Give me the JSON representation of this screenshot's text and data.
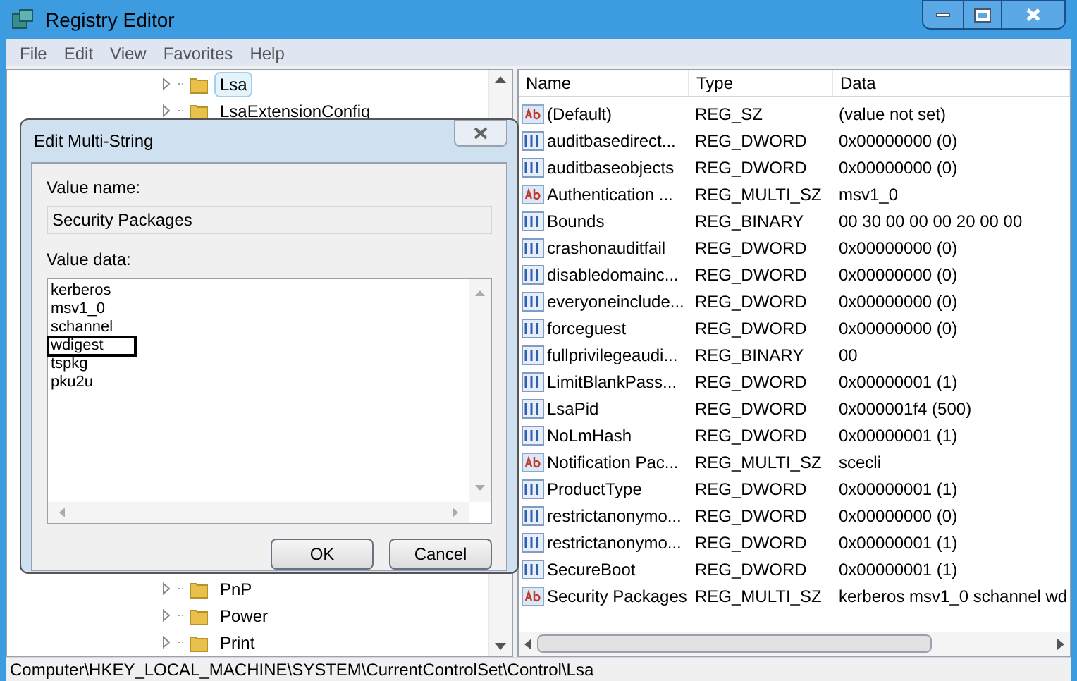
{
  "window": {
    "title": "Registry Editor"
  },
  "menu": [
    "File",
    "Edit",
    "View",
    "Favorites",
    "Help"
  ],
  "tree": {
    "top": [
      {
        "label": "Lsa",
        "selected": true
      },
      {
        "label": "LsaExtensionConfig",
        "selected": false
      }
    ],
    "bottom": [
      {
        "label": "PnP",
        "selected": false
      },
      {
        "label": "Power",
        "selected": false
      },
      {
        "label": "Print",
        "selected": false
      }
    ]
  },
  "table": {
    "columns": [
      "Name",
      "Type",
      "Data"
    ],
    "rows": [
      {
        "kind": "string",
        "name": "(Default)",
        "type": "REG_SZ",
        "data": "(value not set)"
      },
      {
        "kind": "binary",
        "name": "auditbasedirect...",
        "type": "REG_DWORD",
        "data": "0x00000000 (0)"
      },
      {
        "kind": "binary",
        "name": "auditbaseobjects",
        "type": "REG_DWORD",
        "data": "0x00000000 (0)"
      },
      {
        "kind": "string",
        "name": "Authentication ...",
        "type": "REG_MULTI_SZ",
        "data": "msv1_0"
      },
      {
        "kind": "binary",
        "name": "Bounds",
        "type": "REG_BINARY",
        "data": "00 30 00 00 00 20 00 00"
      },
      {
        "kind": "binary",
        "name": "crashonauditfail",
        "type": "REG_DWORD",
        "data": "0x00000000 (0)"
      },
      {
        "kind": "binary",
        "name": "disabledomainc...",
        "type": "REG_DWORD",
        "data": "0x00000000 (0)"
      },
      {
        "kind": "binary",
        "name": "everyoneinclude...",
        "type": "REG_DWORD",
        "data": "0x00000000 (0)"
      },
      {
        "kind": "binary",
        "name": "forceguest",
        "type": "REG_DWORD",
        "data": "0x00000000 (0)"
      },
      {
        "kind": "binary",
        "name": "fullprivilegeaudi...",
        "type": "REG_BINARY",
        "data": "00"
      },
      {
        "kind": "binary",
        "name": "LimitBlankPass...",
        "type": "REG_DWORD",
        "data": "0x00000001 (1)"
      },
      {
        "kind": "binary",
        "name": "LsaPid",
        "type": "REG_DWORD",
        "data": "0x000001f4 (500)"
      },
      {
        "kind": "binary",
        "name": "NoLmHash",
        "type": "REG_DWORD",
        "data": "0x00000001 (1)"
      },
      {
        "kind": "string",
        "name": "Notification Pac...",
        "type": "REG_MULTI_SZ",
        "data": "scecli"
      },
      {
        "kind": "binary",
        "name": "ProductType",
        "type": "REG_DWORD",
        "data": "0x00000001 (1)"
      },
      {
        "kind": "binary",
        "name": "restrictanonymo...",
        "type": "REG_DWORD",
        "data": "0x00000000 (0)"
      },
      {
        "kind": "binary",
        "name": "restrictanonymo...",
        "type": "REG_DWORD",
        "data": "0x00000001 (1)"
      },
      {
        "kind": "binary",
        "name": "SecureBoot",
        "type": "REG_DWORD",
        "data": "0x00000001 (1)"
      },
      {
        "kind": "string",
        "name": "Security Packages",
        "type": "REG_MULTI_SZ",
        "data": "kerberos msv1_0 schannel wd"
      }
    ]
  },
  "dialog": {
    "title": "Edit Multi-String",
    "value_name_label": "Value name:",
    "value_name": "Security Packages",
    "value_data_label": "Value data:",
    "lines": [
      {
        "text": "kerberos",
        "highlighted": false
      },
      {
        "text": "msv1_0",
        "highlighted": false
      },
      {
        "text": "schannel",
        "highlighted": false
      },
      {
        "text": "wdigest",
        "highlighted": true
      },
      {
        "text": "tspkg",
        "highlighted": false
      },
      {
        "text": "pku2u",
        "highlighted": false
      }
    ],
    "buttons": [
      "OK",
      "Cancel"
    ]
  },
  "status_bar": "Computer\\HKEY_LOCAL_MACHINE\\SYSTEM\\CurrentControlSet\\Control\\Lsa"
}
